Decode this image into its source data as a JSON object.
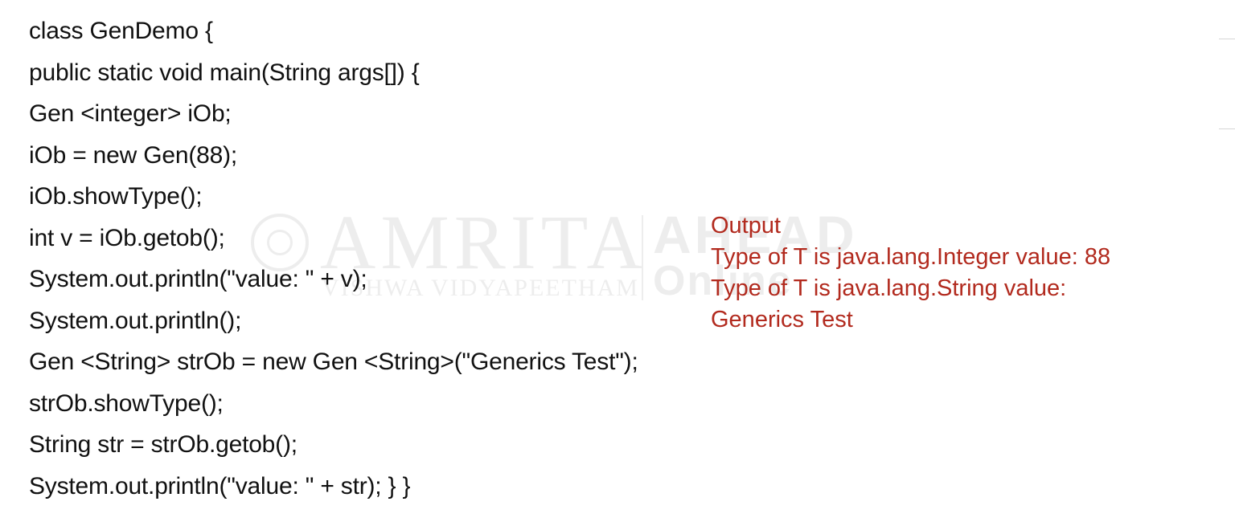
{
  "code": {
    "lines": [
      "class GenDemo {",
      "public static void main(String args[]) {",
      "Gen <integer> iOb;",
      "iOb = new Gen(88);",
      "iOb.showType();",
      "int v = iOb.getob();",
      "System.out.println(\"value: \" + v);",
      "System.out.println();",
      "Gen <String> strOb = new Gen <String>(\"Generics Test\");",
      "strOb.showType();",
      "String str = strOb.getob();",
      "System.out.println(\"value: \" + str); } }"
    ]
  },
  "output": {
    "heading": "Output",
    "lines": [
      "Type of T is java.lang.Integer value: 88",
      "Type of T is java.lang.String value:",
      "Generics Test"
    ]
  },
  "watermark": {
    "name": "AMRITA",
    "subtitle": "VISHWA VIDYAPEETHAM",
    "right_top": "AHEAD",
    "right_bottom": "Online"
  },
  "colors": {
    "code_text": "#111111",
    "output_text": "#b22a1e",
    "background": "#ffffff"
  }
}
